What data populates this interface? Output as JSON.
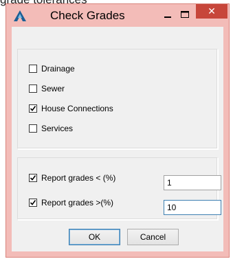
{
  "background_caption": "grade tolerances",
  "window": {
    "title": "Check Grades",
    "close_glyph": "✕",
    "accent_color": "#c7463a",
    "frame_color": "#f3bcb8"
  },
  "layers": [
    {
      "label": "Drainage",
      "checked": false
    },
    {
      "label": "Sewer",
      "checked": false
    },
    {
      "label": "House Connections",
      "checked": true
    },
    {
      "label": "Services",
      "checked": false
    }
  ],
  "report": {
    "less_than": {
      "label": "Report grades < (%)",
      "checked": true,
      "value": "1"
    },
    "greater_than": {
      "label": "Report grades >(%)",
      "checked": true,
      "value": "10"
    }
  },
  "buttons": {
    "ok": "OK",
    "cancel": "Cancel"
  }
}
